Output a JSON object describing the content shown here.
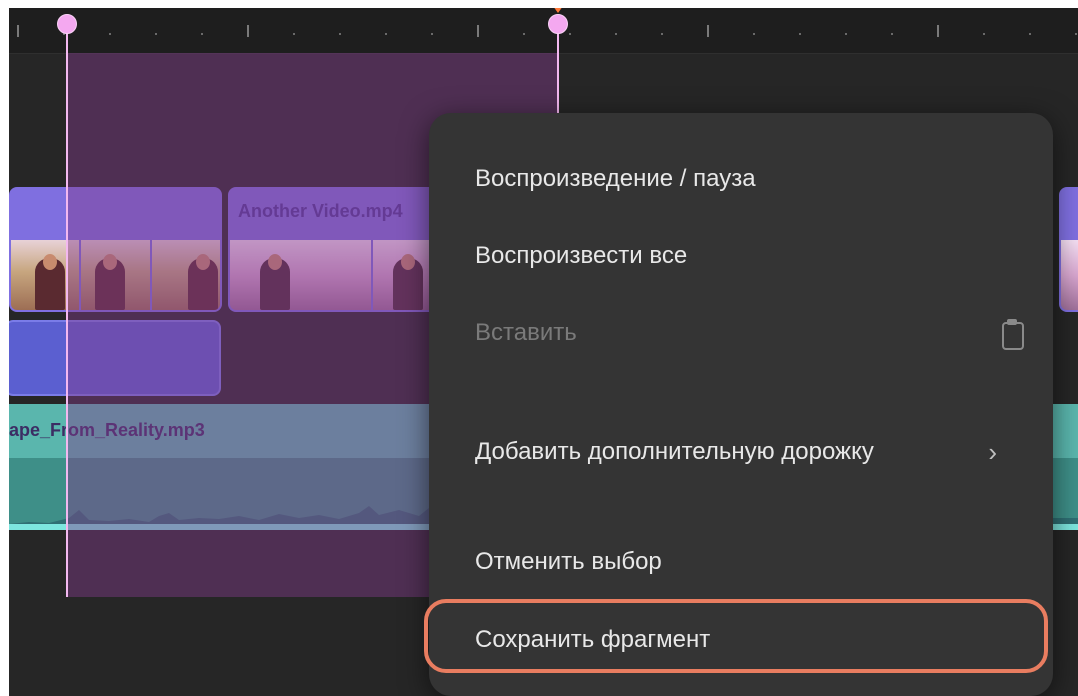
{
  "timeline": {
    "clips": [
      {
        "title": ""
      },
      {
        "title": "Another Video.mp4"
      }
    ],
    "audio_track": {
      "title": "ape_From_Reality.mp3"
    }
  },
  "context_menu": {
    "items": [
      {
        "label": "Воспроизведение / пауза",
        "enabled": true
      },
      {
        "label": "Воспроизвести все",
        "enabled": true
      },
      {
        "label": "Вставить",
        "enabled": false,
        "icon": "clipboard-icon"
      },
      {
        "label": "Добавить дополнительную дорожку",
        "enabled": true,
        "icon": "chevron-right-icon",
        "chevron": "›"
      },
      {
        "label": "Отменить выбор",
        "enabled": true
      },
      {
        "label": "Сохранить фрагмент",
        "enabled": true,
        "highlighted": true
      }
    ]
  },
  "colors": {
    "selection": "#823c8c",
    "marker": "#f4a8f0",
    "highlight_outline": "#e97d60",
    "audio_track": "#47a39c",
    "video_clip": "#7f6fe0"
  }
}
